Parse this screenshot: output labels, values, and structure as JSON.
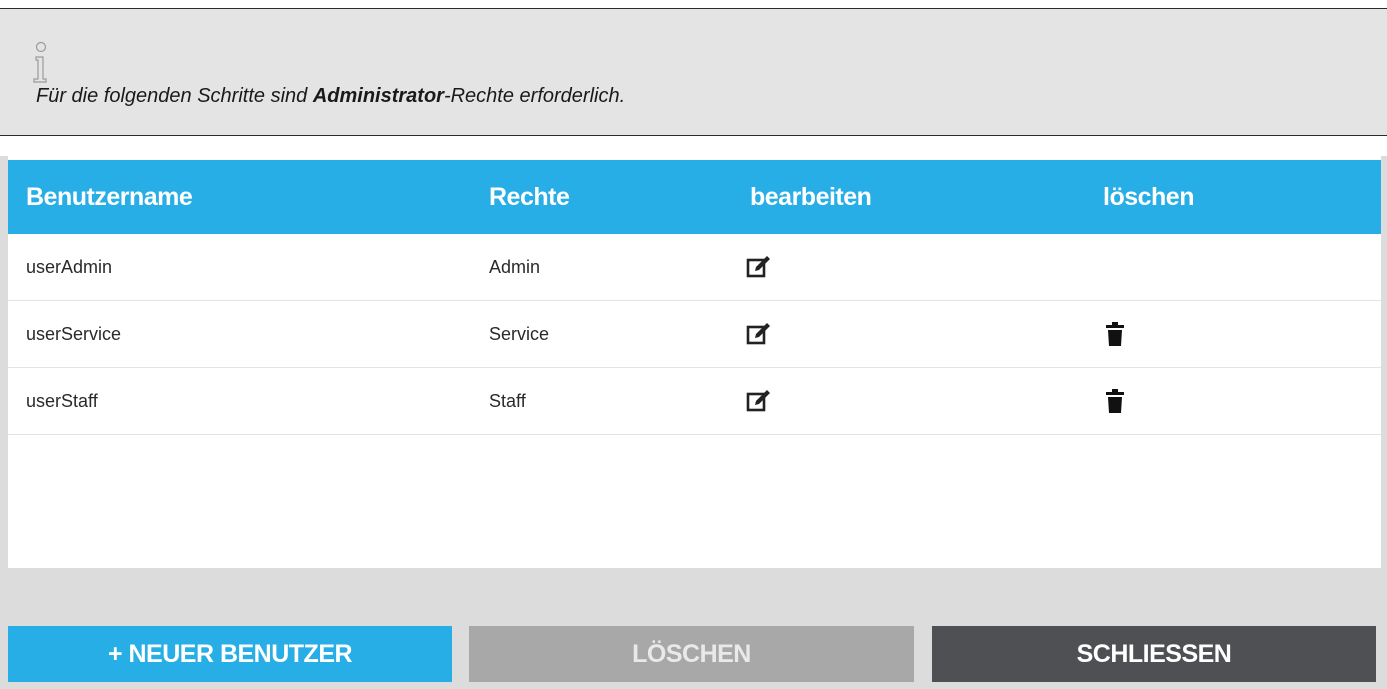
{
  "note": {
    "text_before": "Für die folgenden Schritte sind ",
    "text_bold": "Administrator",
    "text_after": "-Rechte erforderlich."
  },
  "table": {
    "headers": {
      "username": "Benutzername",
      "rights": "Rechte",
      "edit": "bearbeiten",
      "delete": "löschen"
    },
    "rows": [
      {
        "username": "userAdmin",
        "rights": "Admin",
        "deletable": false
      },
      {
        "username": "userService",
        "rights": "Service",
        "deletable": true
      },
      {
        "username": "userStaff",
        "rights": "Staff",
        "deletable": true
      }
    ]
  },
  "buttons": {
    "new_user": "+ NEUER BENUTZER",
    "delete": "LÖSCHEN",
    "close": "SCHLIESSEN"
  },
  "icons": {
    "info": "info-icon",
    "edit": "edit-icon",
    "delete": "trash-icon"
  },
  "colors": {
    "accent": "#27aee6",
    "disabled": "#a8a8a8",
    "dark": "#4f5053"
  }
}
